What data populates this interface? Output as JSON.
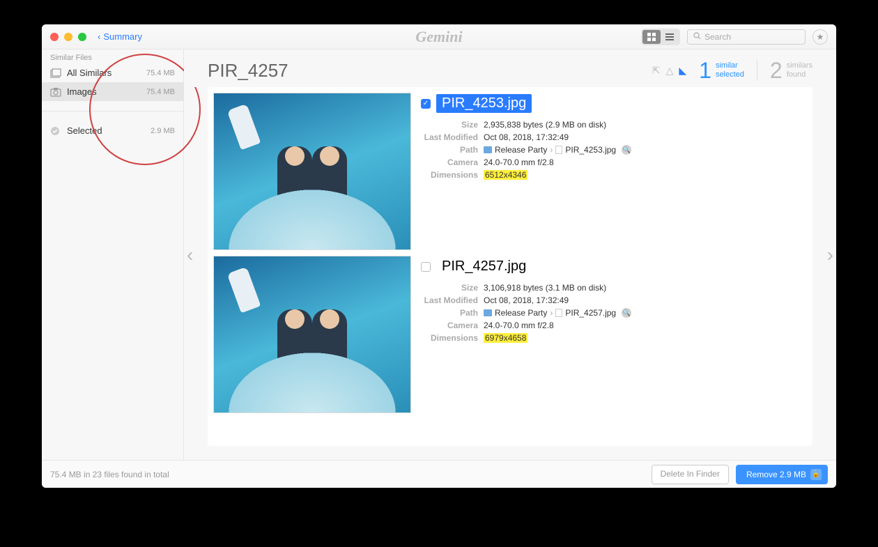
{
  "titlebar": {
    "back_label": "Summary",
    "brand": "Gemini",
    "search_placeholder": "Search"
  },
  "sidebar": {
    "header": "Similar Files",
    "items": [
      {
        "label": "All Similars",
        "size": "75.4 MB"
      },
      {
        "label": "Images",
        "size": "75.4 MB"
      }
    ],
    "selected": {
      "label": "Selected",
      "size": "2.9 MB"
    }
  },
  "detail": {
    "title": "PIR_4257",
    "counts": {
      "selected": {
        "num": "1",
        "l1": "similar",
        "l2": "selected"
      },
      "found": {
        "num": "2",
        "l1": "similars",
        "l2": "found"
      }
    },
    "files": [
      {
        "name": "PIR_4253.jpg",
        "checked": true,
        "size": "2,935,838 bytes (2.9 MB on disk)",
        "modified": "Oct 08, 2018, 17:32:49",
        "path_folder": "Release Party",
        "path_file": "PIR_4253.jpg",
        "camera": "24.0-70.0 mm f/2.8",
        "dimensions": "6512x4346"
      },
      {
        "name": "PIR_4257.jpg",
        "checked": false,
        "size": "3,106,918 bytes (3.1 MB on disk)",
        "modified": "Oct 08, 2018, 17:32:49",
        "path_folder": "Release Party",
        "path_file": "PIR_4257.jpg",
        "camera": "24.0-70.0 mm f/2.8",
        "dimensions": "6979x4658"
      }
    ],
    "meta_labels": {
      "size": "Size",
      "modified": "Last Modified",
      "path": "Path",
      "camera": "Camera",
      "dimensions": "Dimensions"
    }
  },
  "footer": {
    "summary": "75.4 MB in 23 files found in total",
    "delete_label": "Delete In Finder",
    "remove_label": "Remove 2.9 MB"
  }
}
